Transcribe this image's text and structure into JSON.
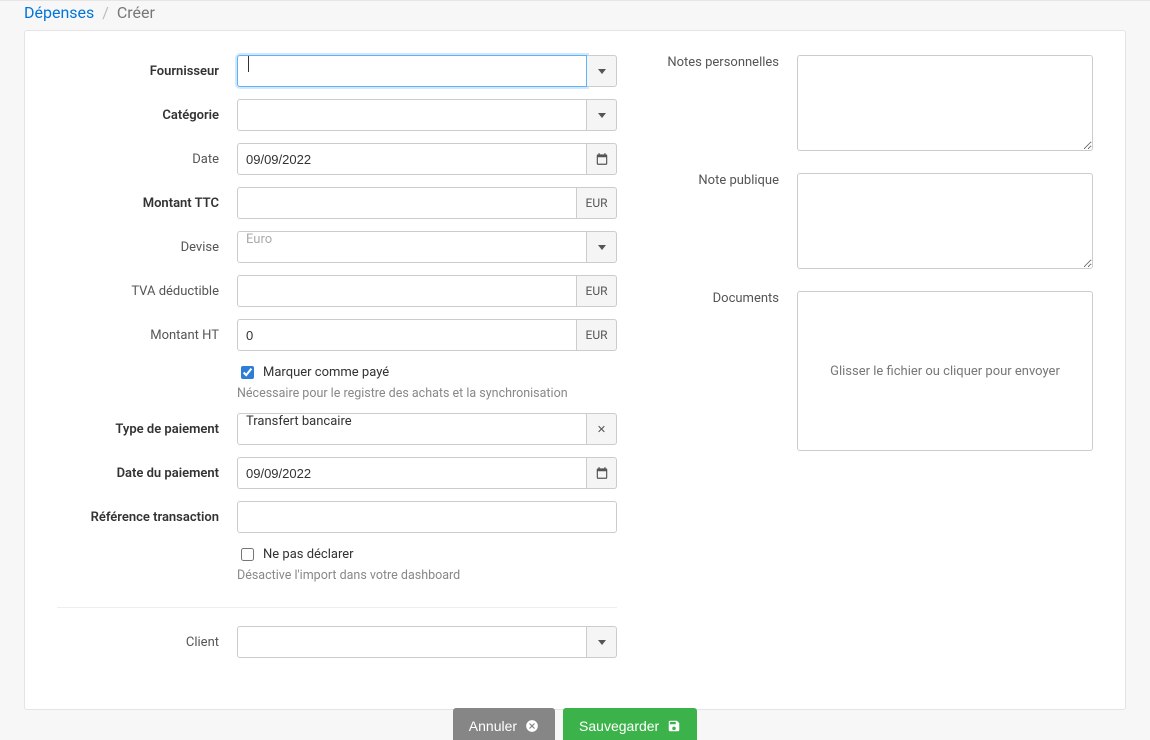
{
  "breadcrumb": {
    "root": "Dépenses",
    "current": "Créer"
  },
  "labels": {
    "fournisseur": "Fournisseur",
    "categorie": "Catégorie",
    "date": "Date",
    "montant_ttc": "Montant TTC",
    "devise": "Devise",
    "tva": "TVA déductible",
    "montant_ht": "Montant HT",
    "type_paiement": "Type de paiement",
    "date_paiement": "Date du paiement",
    "ref_transaction": "Référence transaction",
    "client": "Client",
    "notes_perso": "Notes personnelles",
    "note_publique": "Note publique",
    "documents": "Documents"
  },
  "values": {
    "fournisseur": "",
    "categorie": "",
    "date": "09/09/2022",
    "montant_ttc": "",
    "devise": "Euro",
    "tva": "",
    "montant_ht": "0",
    "mark_paid_checked": true,
    "mark_paid_label": "Marquer comme payé",
    "mark_paid_help": "Nécessaire pour le registre des achats et la synchronisation",
    "type_paiement": "Transfert bancaire",
    "date_paiement": "09/09/2022",
    "ref_transaction": "",
    "no_declare_checked": false,
    "no_declare_label": "Ne pas déclarer",
    "no_declare_help": "Désactive l'import dans votre dashboard",
    "client": "",
    "notes_perso": "",
    "note_publique": "",
    "dropzone": "Glisser le fichier ou cliquer pour envoyer"
  },
  "currency": "EUR",
  "buttons": {
    "cancel": "Annuler",
    "save": "Sauvegarder"
  }
}
